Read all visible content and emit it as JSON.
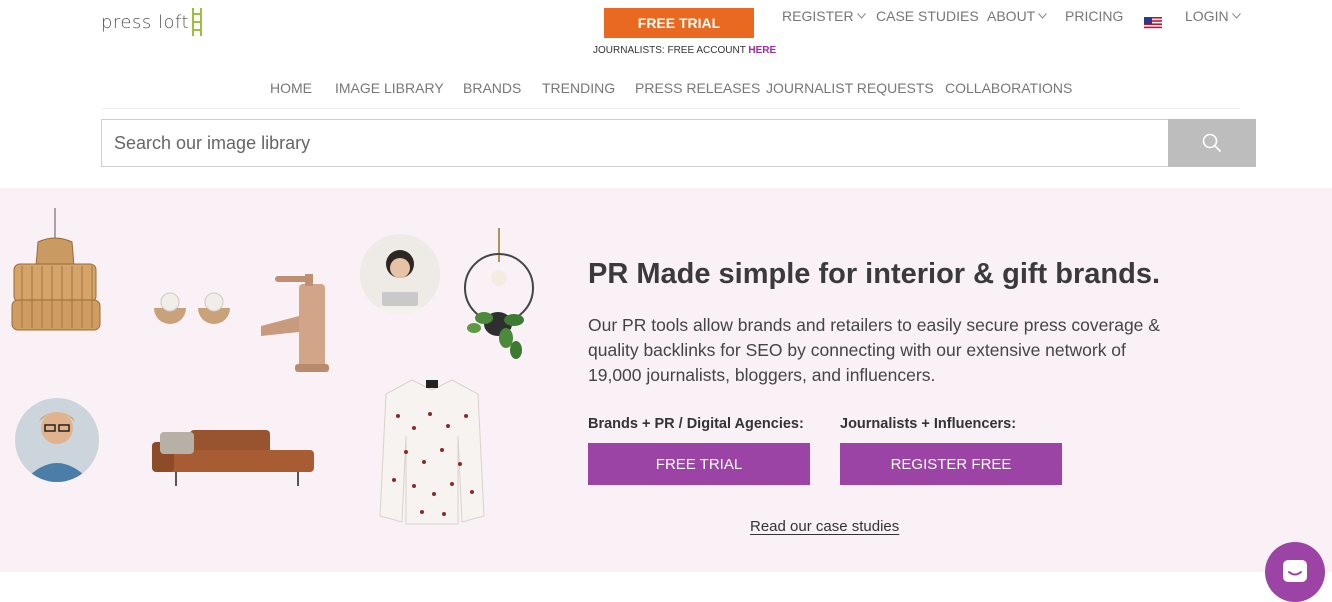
{
  "header": {
    "logo_text": "press loft",
    "free_trial_label": "FREE TRIAL",
    "journalists_note": "JOURNALISTS: FREE ACCOUNT",
    "journalists_link": "HERE",
    "topnav": {
      "register": "REGISTER",
      "case_studies": "CASE STUDIES",
      "about": "ABOUT",
      "pricing": "PRICING",
      "login": "LOGIN"
    }
  },
  "mainnav": {
    "items": [
      "HOME",
      "IMAGE LIBRARY",
      "BRANDS",
      "TRENDING",
      "PRESS RELEASES",
      "JOURNALIST REQUESTS",
      "COLLABORATIONS"
    ]
  },
  "search": {
    "placeholder": "Search our image library"
  },
  "hero": {
    "title": "PR Made simple for interior & gift brands.",
    "body": "Our PR tools allow brands and retailers to easily secure press coverage & quality backlinks for SEO by connecting with our extensive network of 19,000 journalists, bloggers, and influencers.",
    "brands_label": "Brands + PR / Digital Agencies:",
    "brands_button": "FREE TRIAL",
    "journalists_label": "Journalists + Influencers:",
    "journalists_button": "REGISTER FREE",
    "case_studies_link": "Read our case studies"
  },
  "colors": {
    "orange": "#e8691f",
    "purple": "#9b44a6",
    "hero_bg": "#f9f1f5",
    "search_button": "#bdbdbd"
  },
  "icons": [
    "ladder-icon",
    "chevron-down-icon",
    "us-flag-icon",
    "search-icon",
    "chat-icon"
  ]
}
